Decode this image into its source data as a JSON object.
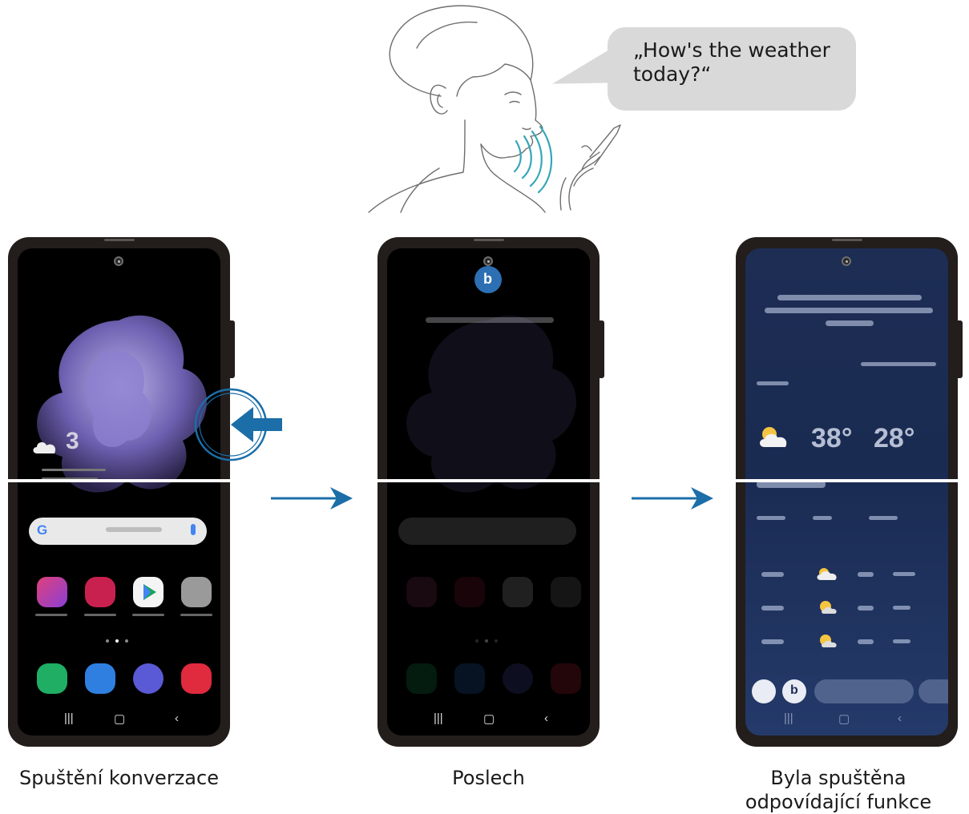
{
  "speech": {
    "quote": "„How's the weather today?“"
  },
  "steps": [
    {
      "caption": "Spuštění konverzace"
    },
    {
      "caption": "Poslech"
    },
    {
      "caption": "Byla spuštěna odpovídající funkce"
    }
  ],
  "colors": {
    "accent_blue": "#1b6ea8",
    "phone_frame": "#231d1b",
    "bubble": "#d9d9d9"
  },
  "icons": [
    "person-illustration",
    "sound-wave-icon",
    "side-key-press-icon",
    "right-arrow-icon",
    "bixby-icon",
    "weather-icon"
  ]
}
